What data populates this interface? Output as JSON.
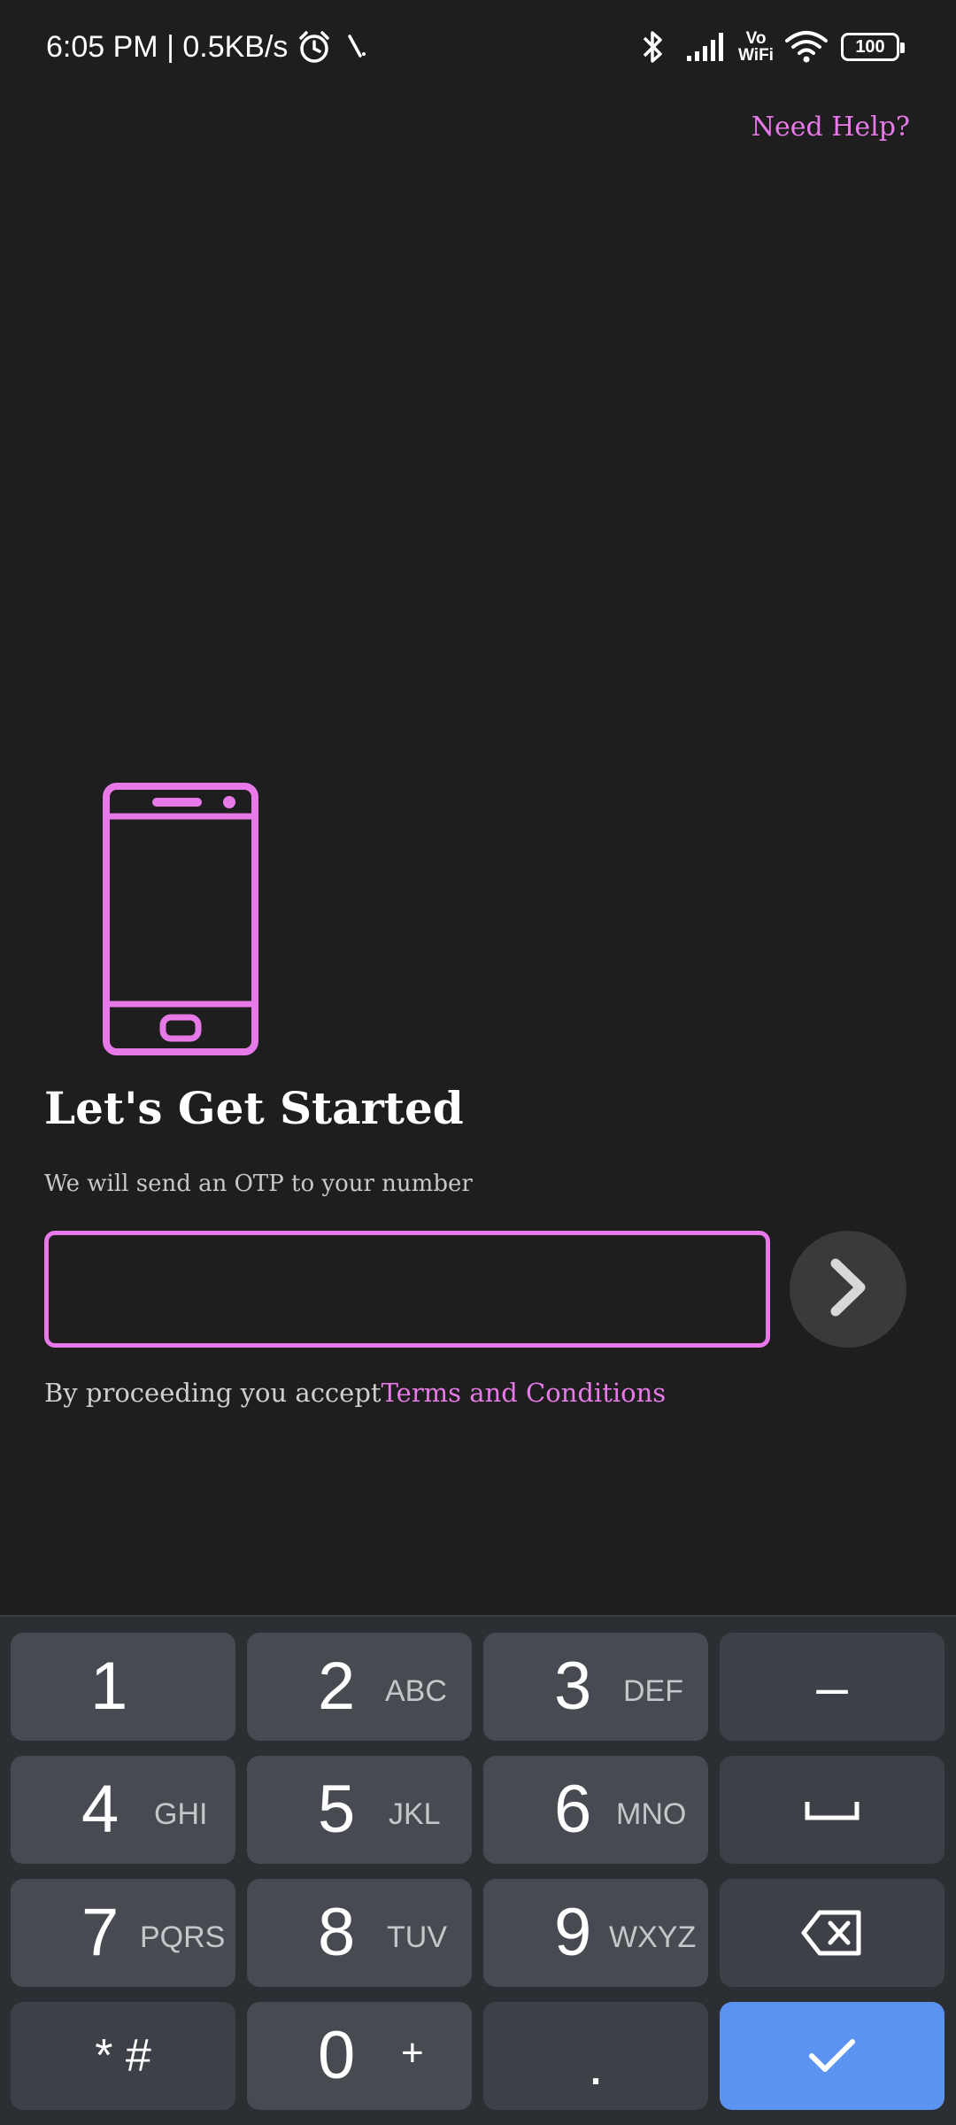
{
  "status_bar": {
    "time": "6:05 PM | 0.5KB/s",
    "vo_label": "Vo",
    "wifi_label": "WiFi",
    "battery": "100",
    "icons": [
      "alarm-icon",
      "bluetooth-icon",
      "signal-icon",
      "wifi-icon",
      "battery-icon"
    ]
  },
  "header": {
    "help_label": "Need Help?"
  },
  "main": {
    "title": "Let's Get Started",
    "subtitle": "We will send an OTP to your number",
    "phone_input_value": "",
    "next_icon": "chevron-right-icon",
    "terms_prefix": "By proceeding you accept",
    "terms_link": "Terms and Conditions"
  },
  "colors": {
    "accent": "#e879e8",
    "background": "#1e1e1e",
    "keyboard_bg": "#2b2e33",
    "key_bg": "#474a50",
    "enter_key": "#5b94f0"
  },
  "keyboard": {
    "keys": [
      {
        "digit": "1",
        "letters": ""
      },
      {
        "digit": "2",
        "letters": "ABC"
      },
      {
        "digit": "3",
        "letters": "DEF"
      },
      {
        "symbol": "–"
      },
      {
        "digit": "4",
        "letters": "GHI"
      },
      {
        "digit": "5",
        "letters": "JKL"
      },
      {
        "digit": "6",
        "letters": "MNO"
      },
      {
        "icon": "space-icon"
      },
      {
        "digit": "7",
        "letters": "PQRS"
      },
      {
        "digit": "8",
        "letters": "TUV"
      },
      {
        "digit": "9",
        "letters": "WXYZ"
      },
      {
        "icon": "backspace-icon"
      },
      {
        "symbol": "* #"
      },
      {
        "digit": "0",
        "letters": "+"
      },
      {
        "symbol": "."
      },
      {
        "icon": "check-icon"
      }
    ]
  }
}
